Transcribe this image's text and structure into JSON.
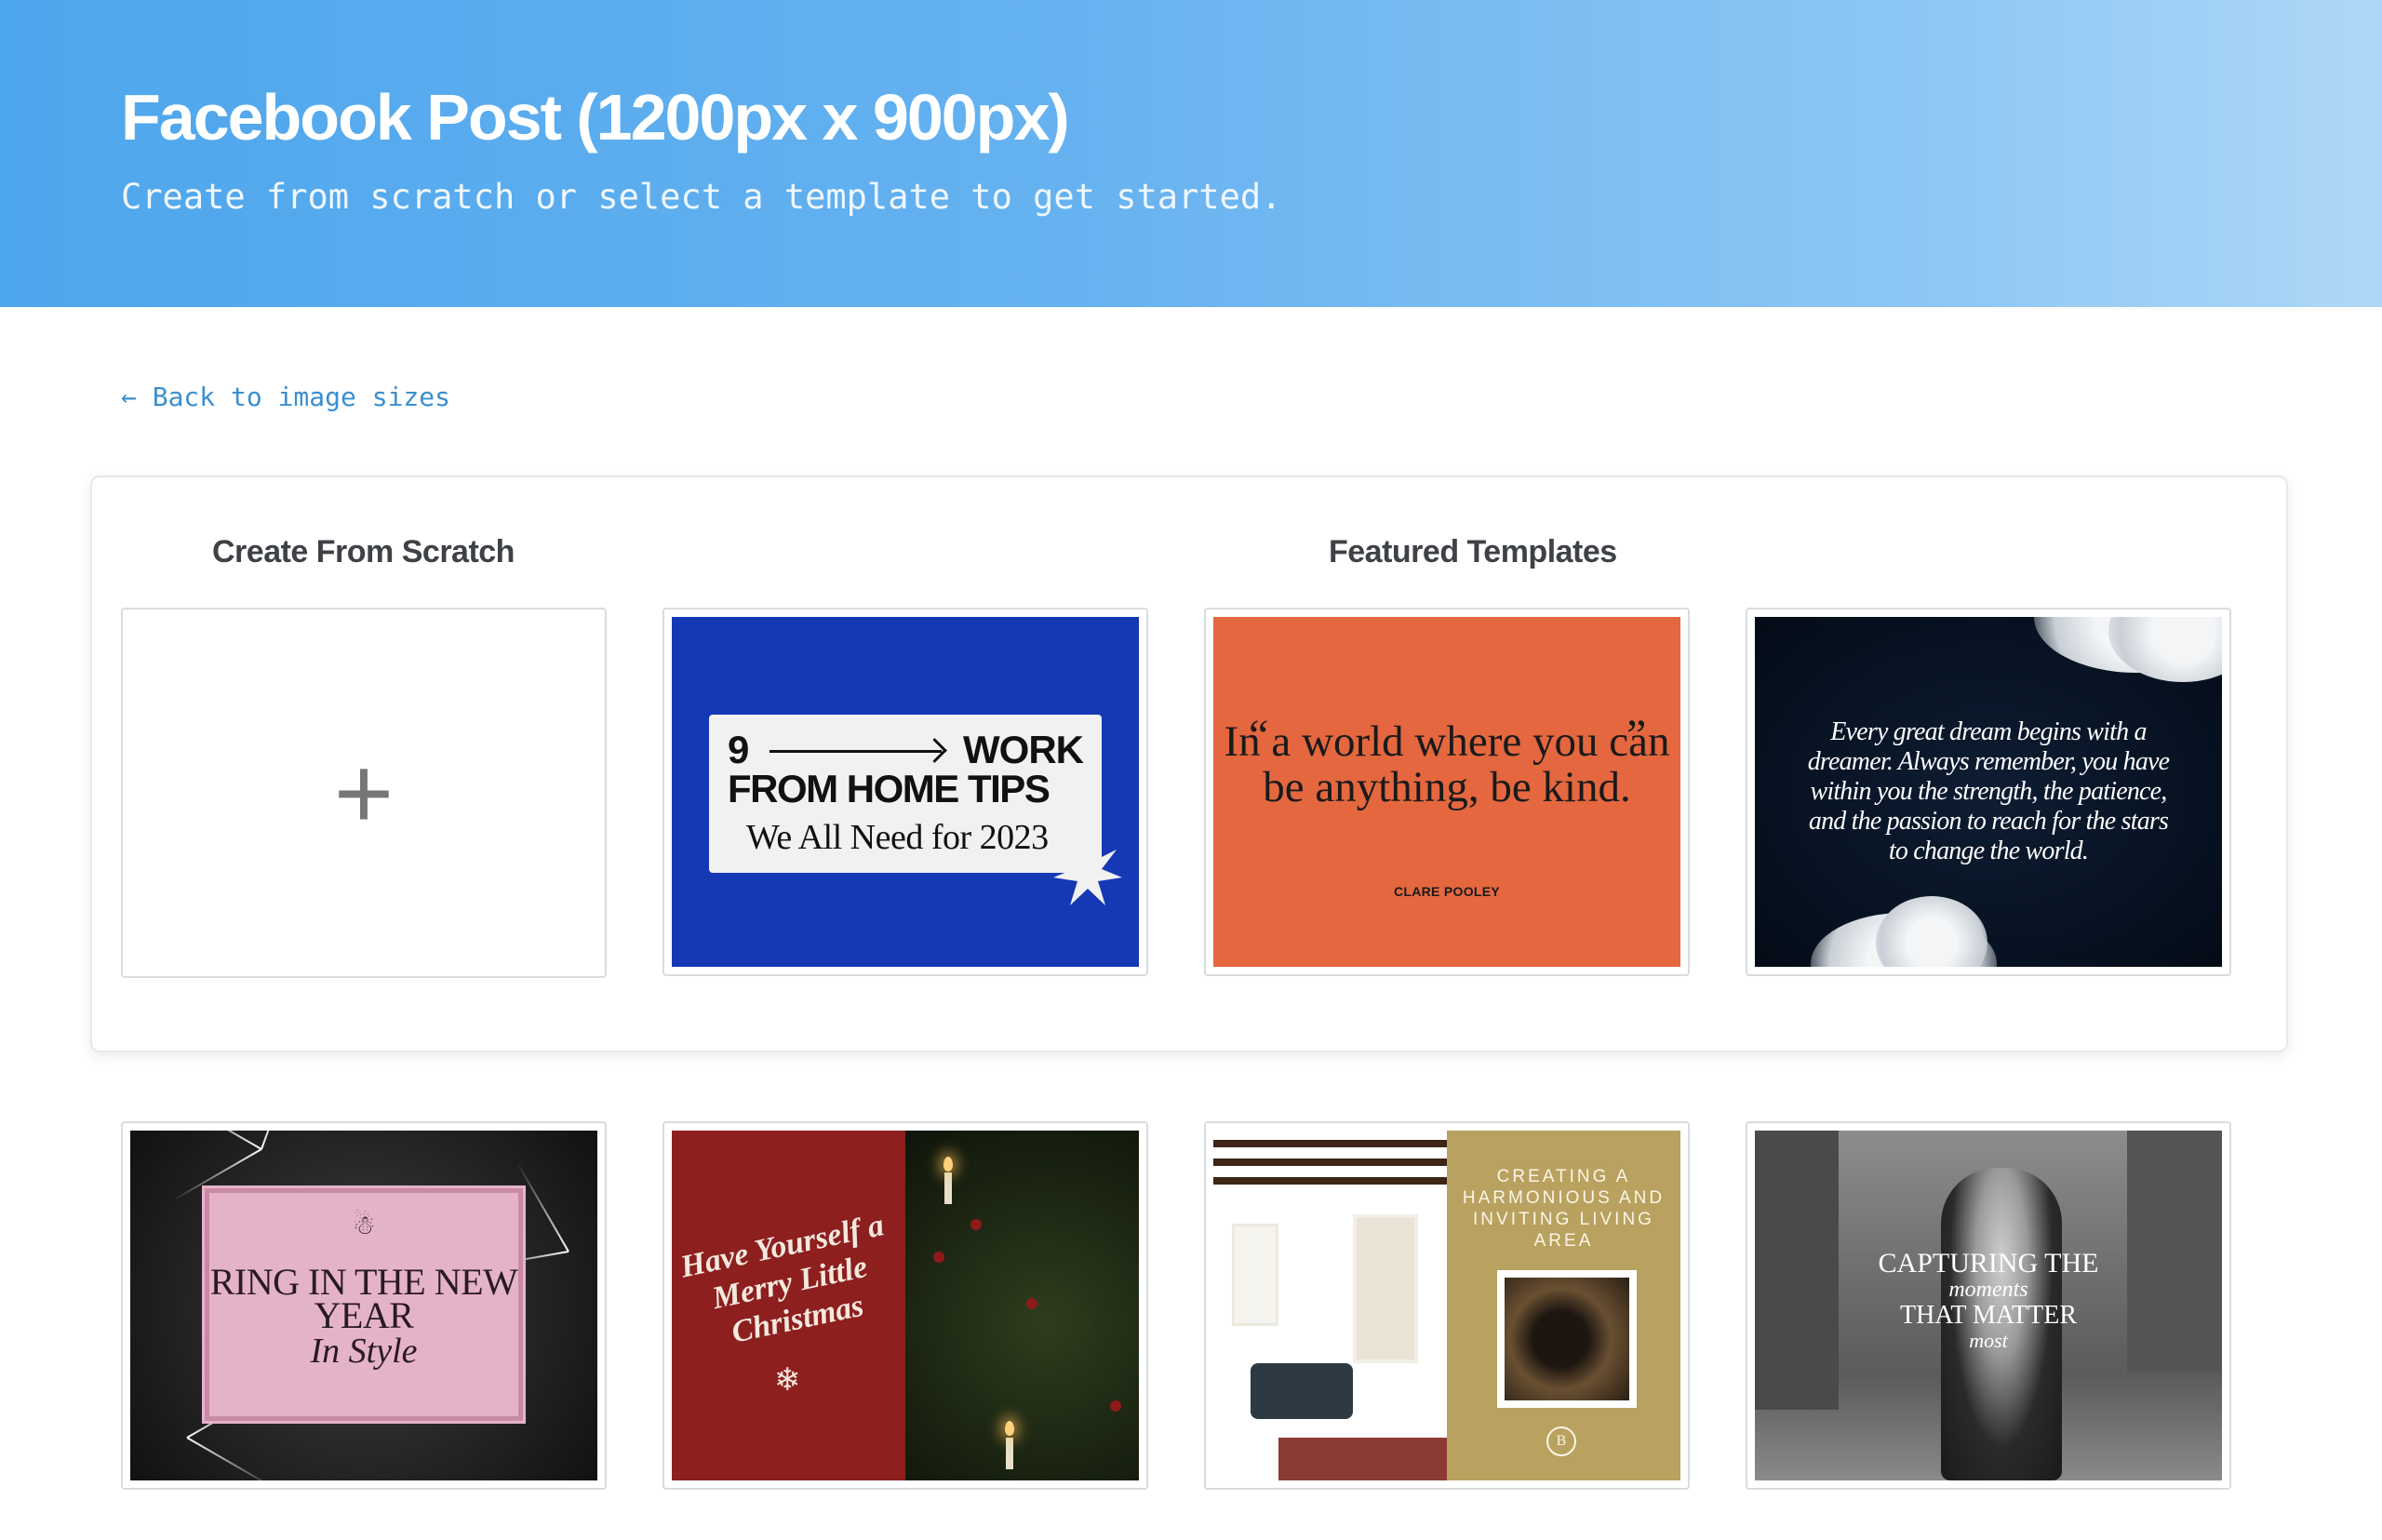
{
  "header": {
    "title": "Facebook Post (1200px x 900px)",
    "subtitle": "Create from scratch or select a template to get started."
  },
  "back_link": {
    "label": "← Back to image sizes"
  },
  "sections": {
    "scratch_title": "Create From Scratch",
    "featured_title": "Featured Templates"
  },
  "scratch_card": {
    "icon": "plus-icon",
    "symbol": "+"
  },
  "templates": [
    {
      "id": "work-from-home-tips",
      "line1": "9",
      "line1b": "WORK",
      "line2": "FROM HOME  TIPS",
      "line3": "We All Need for 2023"
    },
    {
      "id": "be-kind-quote",
      "open_quote": "“",
      "close_quote": "”",
      "quote": "In a world where you can be anything, be kind.",
      "author": "CLARE POOLEY"
    },
    {
      "id": "great-dream-quote",
      "quote": "Every great dream begins with a dreamer. Always remember, you have within you the strength, the patience, and the passion to reach for the stars to change the world."
    },
    {
      "id": "new-year",
      "mark": "☃",
      "title": "RING IN THE NEW YEAR",
      "script": "In Style"
    },
    {
      "id": "merry-christmas",
      "script": "Have Yourself a Merry Little Christmas",
      "flake": "❄"
    },
    {
      "id": "living-area",
      "caption": "CREATING A HARMONIOUS AND INVITING LIVING AREA",
      "badge": "B"
    },
    {
      "id": "wedding-moments",
      "line1": "CAPTURING THE",
      "line2": "moments",
      "line3": "THAT MATTER",
      "line4": "most"
    }
  ],
  "colors": {
    "header_gradient_start": "#4ea6ec",
    "header_gradient_end": "#aed7f7",
    "link": "#3b8fd0",
    "section_title": "#3e4145"
  }
}
